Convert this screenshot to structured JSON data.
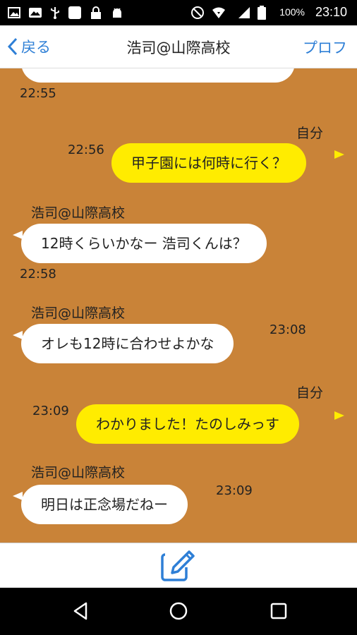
{
  "status_bar": {
    "time": "23:10",
    "battery": "100%",
    "icons": [
      "image-icon",
      "photo-icon",
      "usb-icon",
      "square-icon",
      "lock-icon",
      "android-icon",
      "do-not-disturb-icon",
      "wifi-icon",
      "signal-icon",
      "battery-icon"
    ]
  },
  "header": {
    "back_label": "戻る",
    "title": "浩司@山際高校",
    "profile_label": "プロフ"
  },
  "chat": {
    "partial_top": {
      "time": "22:55"
    },
    "messages": [
      {
        "side": "right",
        "sender": "自分",
        "time": "22:56",
        "text": "甲子園には何時に行く？"
      },
      {
        "side": "left",
        "sender": "浩司@山際高校",
        "time": "22:58",
        "text": "12時くらいかなー 浩司くんは？"
      },
      {
        "side": "left",
        "sender": "浩司@山際高校",
        "time": "23:08",
        "text": "オレも12時に合わせよかな"
      },
      {
        "side": "right",
        "sender": "自分",
        "time": "23:09",
        "text": "わかりました！たのしみっす"
      },
      {
        "side": "left",
        "sender": "浩司@山際高校",
        "time": "23:09",
        "text": "明日は正念場だねー"
      }
    ]
  },
  "colors": {
    "chat_background": "#c98338",
    "own_bubble": "#ffec00",
    "other_bubble": "#ffffff",
    "link_blue": "#2e7fd6"
  }
}
